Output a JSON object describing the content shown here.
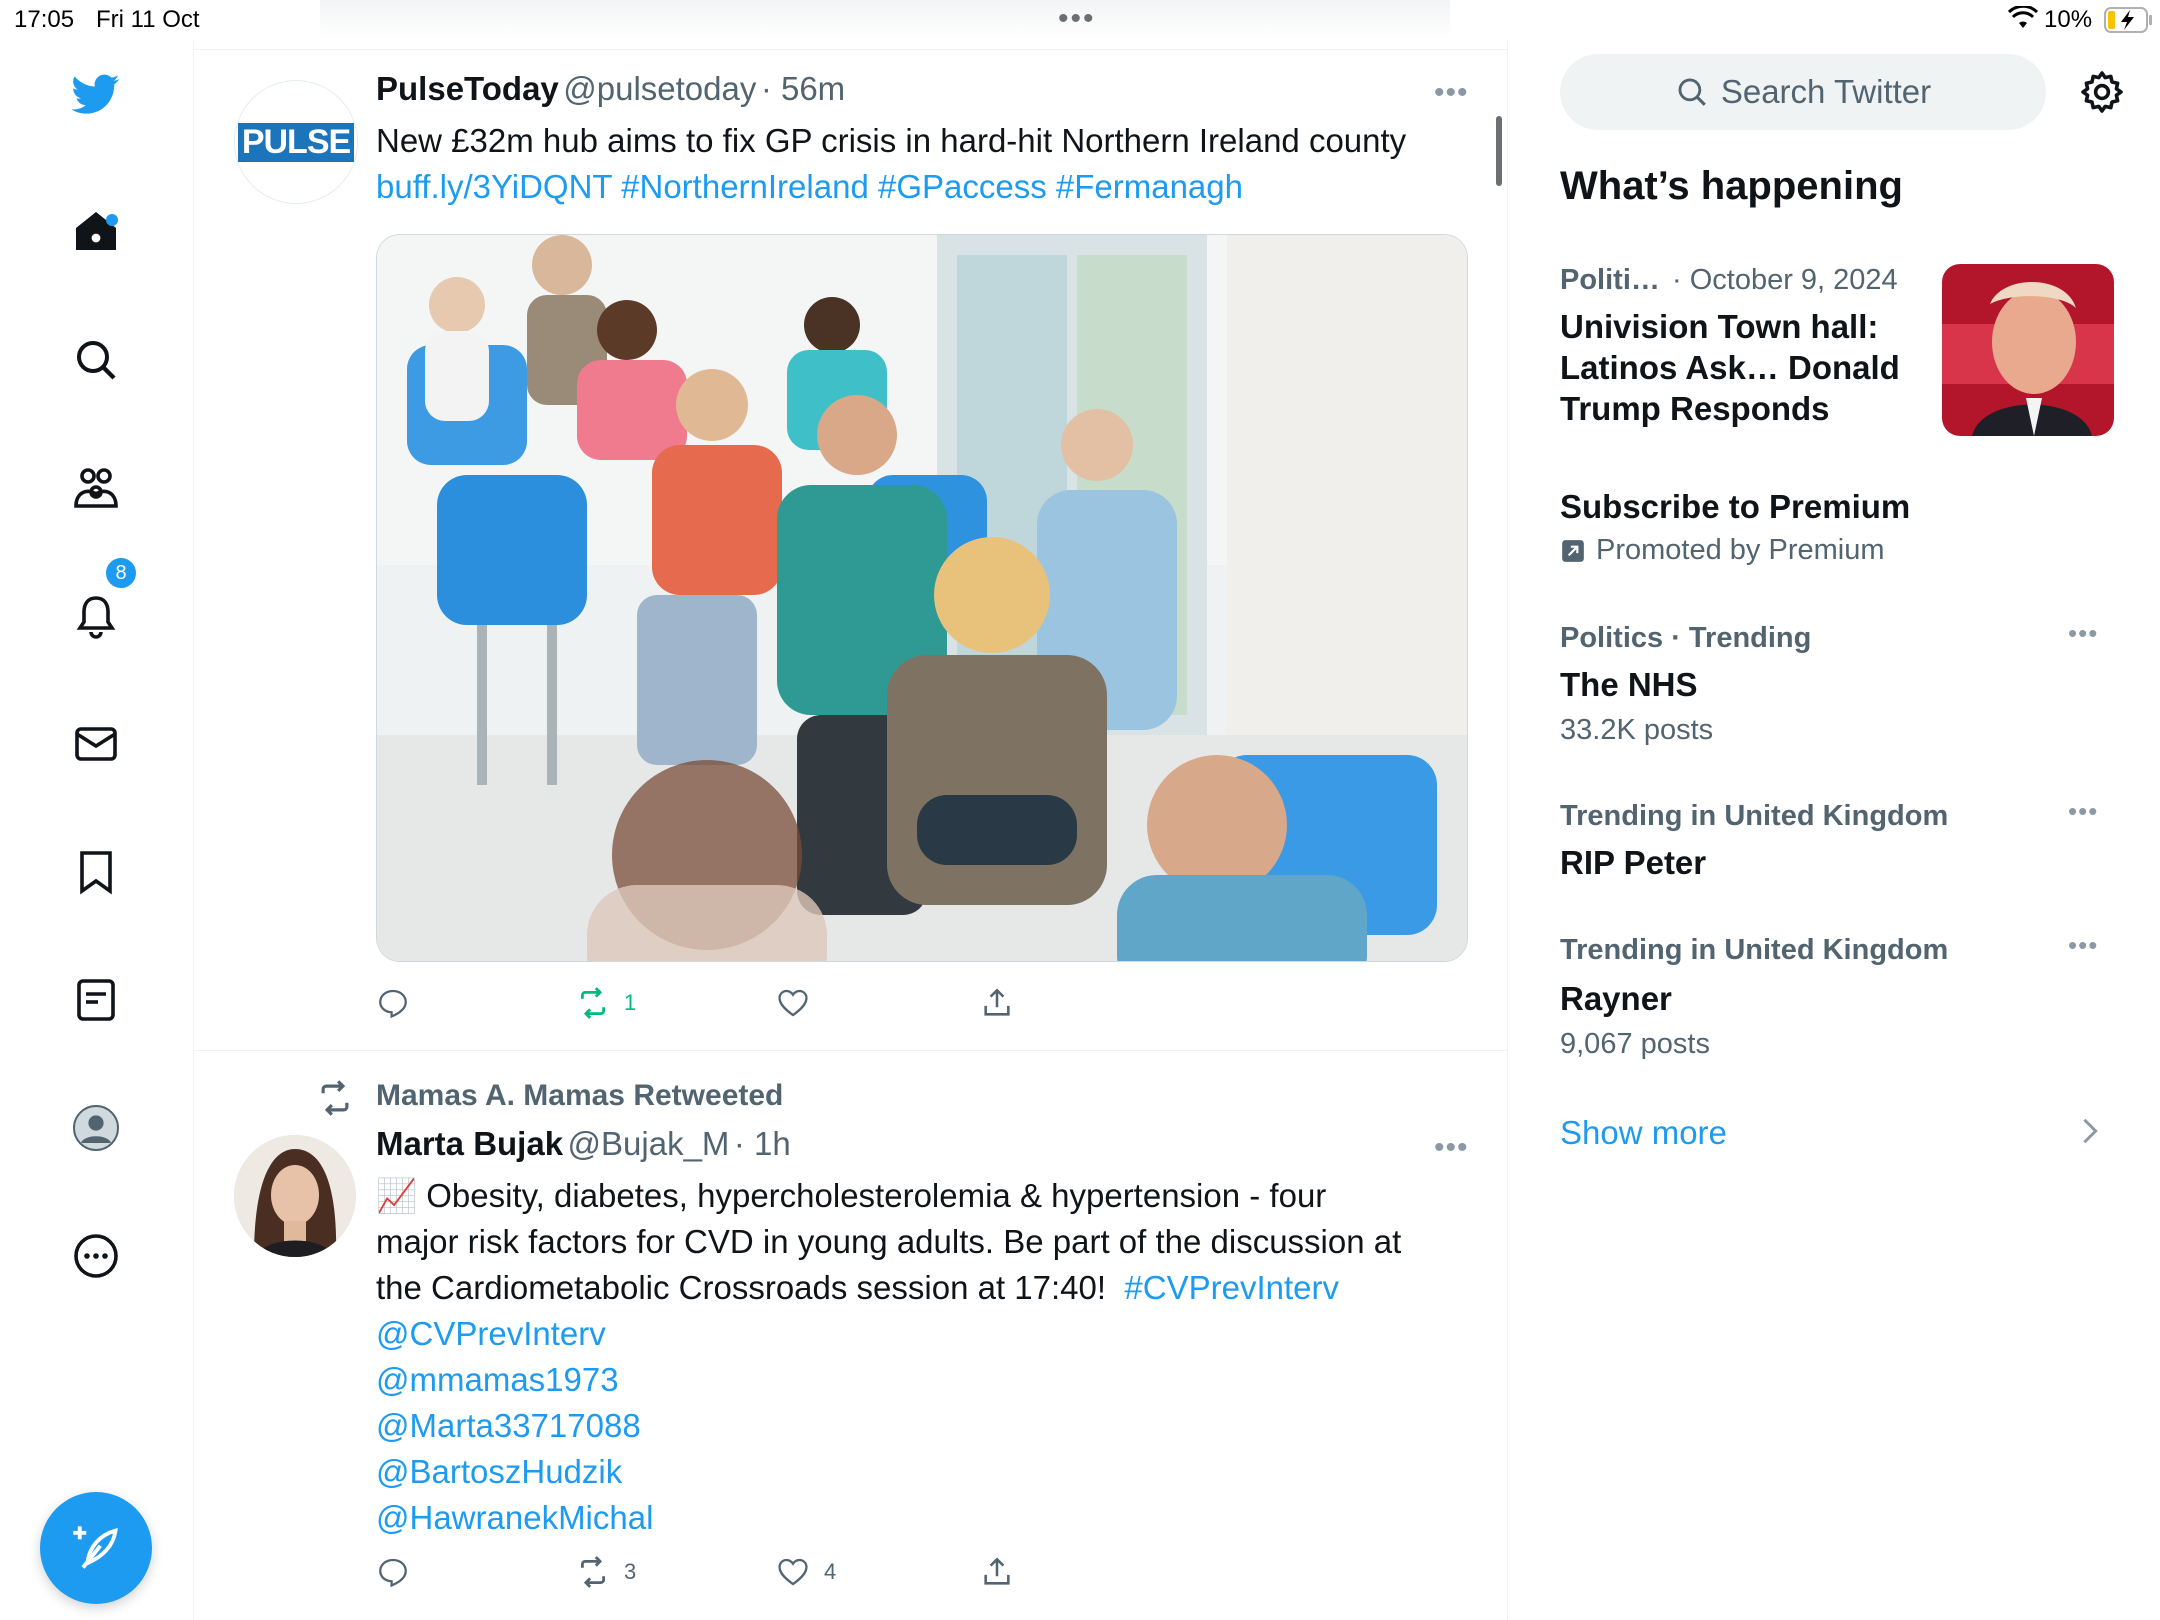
{
  "status_bar": {
    "time": "17:05",
    "date": "Fri 11 Oct",
    "battery": "10%",
    "icons": [
      "wifi-icon",
      "battery-charging-icon"
    ]
  },
  "nav": {
    "items": [
      {
        "name": "twitter-logo-icon"
      },
      {
        "name": "home-icon"
      },
      {
        "name": "explore-icon"
      },
      {
        "name": "communities-icon"
      },
      {
        "name": "notifications-icon",
        "badge": "8"
      },
      {
        "name": "messages-icon"
      },
      {
        "name": "bookmarks-icon"
      },
      {
        "name": "lists-icon"
      },
      {
        "name": "profile-icon"
      },
      {
        "name": "more-icon"
      }
    ],
    "compose": {
      "icon": "compose-feather-icon"
    }
  },
  "feed": {
    "tweets": [
      {
        "avatar_text": "PULSE",
        "name": "PulseToday",
        "handle": "@pulsetoday",
        "time": "· 56m",
        "text": "New £32m hub aims to fix GP crisis in hard-hit Northern Ireland county",
        "links": "buff.ly/3YiDQNT #NorthernIreland #GPaccess #Fermanagh",
        "actions": {
          "replies": "",
          "retweets": "1",
          "likes": "",
          "share": ""
        }
      },
      {
        "retweeted_by": "Mamas A. Mamas Retweeted",
        "name": "Marta Bujak",
        "handle": "@Bujak_M",
        "time": "· 1h",
        "text_line1": "📈 Obesity, diabetes, hypercholesterolemia & hypertension - four",
        "text_line2": "major risk factors for CVD in young adults. Be part of the discussion at",
        "text_line3": "the Cardiometabolic Crossroads session at 17:40!",
        "hashtag": "#CVPrevInterv",
        "mentions": [
          "@CVPrevInterv",
          "@mmamas1973",
          "@Marta33717088",
          "@BartoszHudzik",
          "@HawranekMichal"
        ],
        "actions": {
          "replies": "",
          "retweets": "3",
          "likes": "4",
          "share": ""
        }
      }
    ]
  },
  "sidebar": {
    "search_placeholder": "Search Twitter",
    "heading": "What’s happening",
    "trends": [
      {
        "category": "Politi…",
        "date": "· October 9, 2024",
        "title_lines": [
          "Univision Town hall:",
          "Latinos Ask… Donald",
          "Trump Responds"
        ]
      },
      {
        "title": "Subscribe to Premium",
        "promoted": "Promoted by Premium"
      },
      {
        "category": "Politics · Trending",
        "title": "The NHS",
        "count": "33.2K posts"
      },
      {
        "category": "Trending in United Kingdom",
        "title": "RIP Peter"
      },
      {
        "category": "Trending in United Kingdom",
        "title": "Rayner",
        "count": "9,067 posts"
      }
    ],
    "show_more": "Show more"
  },
  "colors": {
    "accent": "#1d9bf0",
    "retweet_green": "#00ba7c",
    "muted": "#536471",
    "text": "#0f1419"
  }
}
